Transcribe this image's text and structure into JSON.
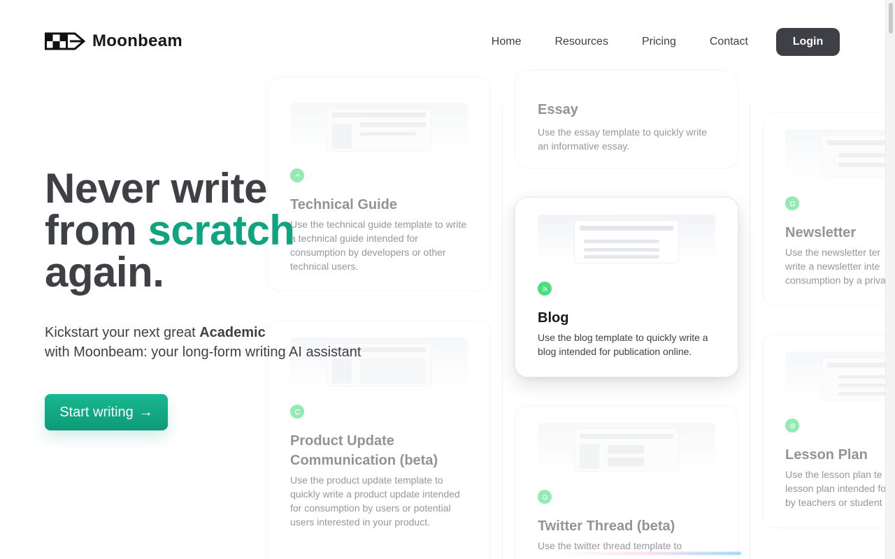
{
  "brand": {
    "name": "Moonbeam"
  },
  "nav": {
    "items": [
      "Home",
      "Resources",
      "Pricing",
      "Contact"
    ],
    "login_label": "Login"
  },
  "hero": {
    "title_line1": "Never write",
    "title_line2_pre": "from ",
    "title_line2_accent": "scratch",
    "title_line3": "again.",
    "subtitle_pre": "Kickstart your next great ",
    "subtitle_bold": "Academic",
    "subtitle_post": "with Moonbeam: your long-form writing AI assistant",
    "cta_label": "Start writing",
    "cta_arrow": "→"
  },
  "cards": {
    "technical_guide": {
      "title": "Technical Guide",
      "desc": "Use the technical guide template to write a technical guide intended for consumption by developers or other technical users.",
      "icon": "chevron-up-icon"
    },
    "product_update": {
      "title": "Product Update Communication (beta)",
      "desc": "Use the product update template to quickly write a product update intended for consumption by users or potential users interested in your product.",
      "icon": "refresh-icon"
    },
    "essay": {
      "title": "Essay",
      "desc": "Use the essay template to quickly write an informative essay."
    },
    "blog": {
      "title": "Blog",
      "desc": "Use the blog template to quickly write a blog intended for publication online.",
      "icon": "rss-icon"
    },
    "twitter_thread": {
      "title": "Twitter Thread (beta)",
      "desc": "Use the twitter thread template to",
      "icon": "chat-icon"
    },
    "newsletter": {
      "title": "Newsletter",
      "desc": "Use the newsletter ter write a newsletter inte consumption by a priva",
      "icon": "newspaper-icon"
    },
    "lesson_plan": {
      "title": "Lesson Plan",
      "desc": "Use the lesson plan te lesson plan intended fo by teachers or student",
      "icon": "clock-icon"
    }
  },
  "colors": {
    "accent": "#10a37f",
    "icon_green": "#4ade80",
    "dark": "#3f3f46"
  }
}
